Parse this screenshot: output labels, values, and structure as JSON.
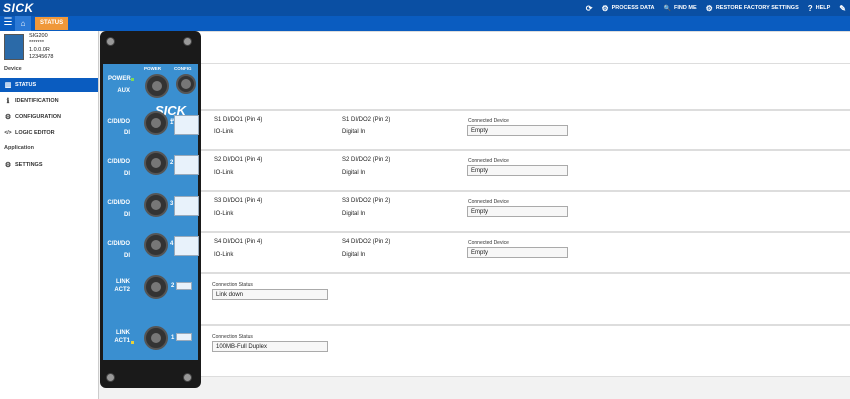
{
  "header": {
    "logo": "SICK",
    "nav": [
      {
        "icon": "refresh-icon",
        "glyph": "⟳",
        "label": ""
      },
      {
        "icon": "gears-icon",
        "glyph": "⚙",
        "label": "PROCESS DATA"
      },
      {
        "icon": "search-icon",
        "glyph": "🔍",
        "label": "FIND ME"
      },
      {
        "icon": "gears-icon",
        "glyph": "⚙",
        "label": "RESTORE FACTORY SETTINGS"
      },
      {
        "icon": "help-icon",
        "glyph": "?",
        "label": "HELP"
      },
      {
        "icon": "pencil-icon",
        "glyph": "✎",
        "label": ""
      }
    ]
  },
  "breadcrumb": {
    "label": "STATUS"
  },
  "sidebar": {
    "device": {
      "name": "SIG200",
      "stars": "*******",
      "version": "1.0.0.0R",
      "serial": "12345678"
    },
    "section_device": "Device",
    "items_device": [
      {
        "icon": "chart-icon",
        "glyph": "▥",
        "label": "STATUS"
      },
      {
        "icon": "info-icon",
        "glyph": "ℹ",
        "label": "IDENTIFICATION"
      },
      {
        "icon": "gears-icon",
        "glyph": "⚙",
        "label": "CONFIGURATION"
      },
      {
        "icon": "code-icon",
        "glyph": "</>",
        "label": "LOGIC EDITOR"
      }
    ],
    "section_application": "Application",
    "items_application": [
      {
        "icon": "gears-icon",
        "glyph": "⚙",
        "label": "SETTINGS"
      }
    ]
  },
  "device_image": {
    "labels": [
      "POWER",
      "AUX",
      "C/DI/DO",
      "DI",
      "C/DI/DO",
      "DI",
      "C/DI/DO",
      "DI",
      "C/DI/DO",
      "DI",
      "LINK",
      "ACT2",
      "LINK",
      "ACT1"
    ],
    "top_labels": [
      "POWER",
      "CONFIG"
    ],
    "brand": "SICK",
    "model": "SIG200",
    "port_numbers": [
      "1",
      "2",
      "3",
      "4",
      "2",
      "1"
    ]
  },
  "ports": [
    {
      "pin4_label": "S1 DI/DO1 (Pin 4)",
      "pin4_value": "IO-Link",
      "pin2_label": "S1 DI/DO2 (Pin 2)",
      "pin2_value": "Digital In",
      "cd_label": "Connected Device",
      "cd_value": "Empty"
    },
    {
      "pin4_label": "S2 DI/DO1 (Pin 4)",
      "pin4_value": "IO-Link",
      "pin2_label": "S2 DI/DO2 (Pin 2)",
      "pin2_value": "Digital In",
      "cd_label": "Connected Device",
      "cd_value": "Empty"
    },
    {
      "pin4_label": "S3 DI/DO1 (Pin 4)",
      "pin4_value": "IO-Link",
      "pin2_label": "S3 DI/DO2 (Pin 2)",
      "pin2_value": "Digital In",
      "cd_label": "Connected Device",
      "cd_value": "Empty"
    },
    {
      "pin4_label": "S4 DI/DO1 (Pin 4)",
      "pin4_value": "IO-Link",
      "pin2_label": "S4 DI/DO2 (Pin 2)",
      "pin2_value": "Digital In",
      "cd_label": "Connected Device",
      "cd_value": "Empty"
    }
  ],
  "links": [
    {
      "label": "Connection Status",
      "value": "Link down"
    },
    {
      "label": "Connection Status",
      "value": "100MB-Full Duplex"
    }
  ],
  "colors": {
    "topbar": "#0a4fa3",
    "accent": "#0a5cc0",
    "crumb": "#f0983a",
    "device_blue": "#3a8fd0"
  }
}
